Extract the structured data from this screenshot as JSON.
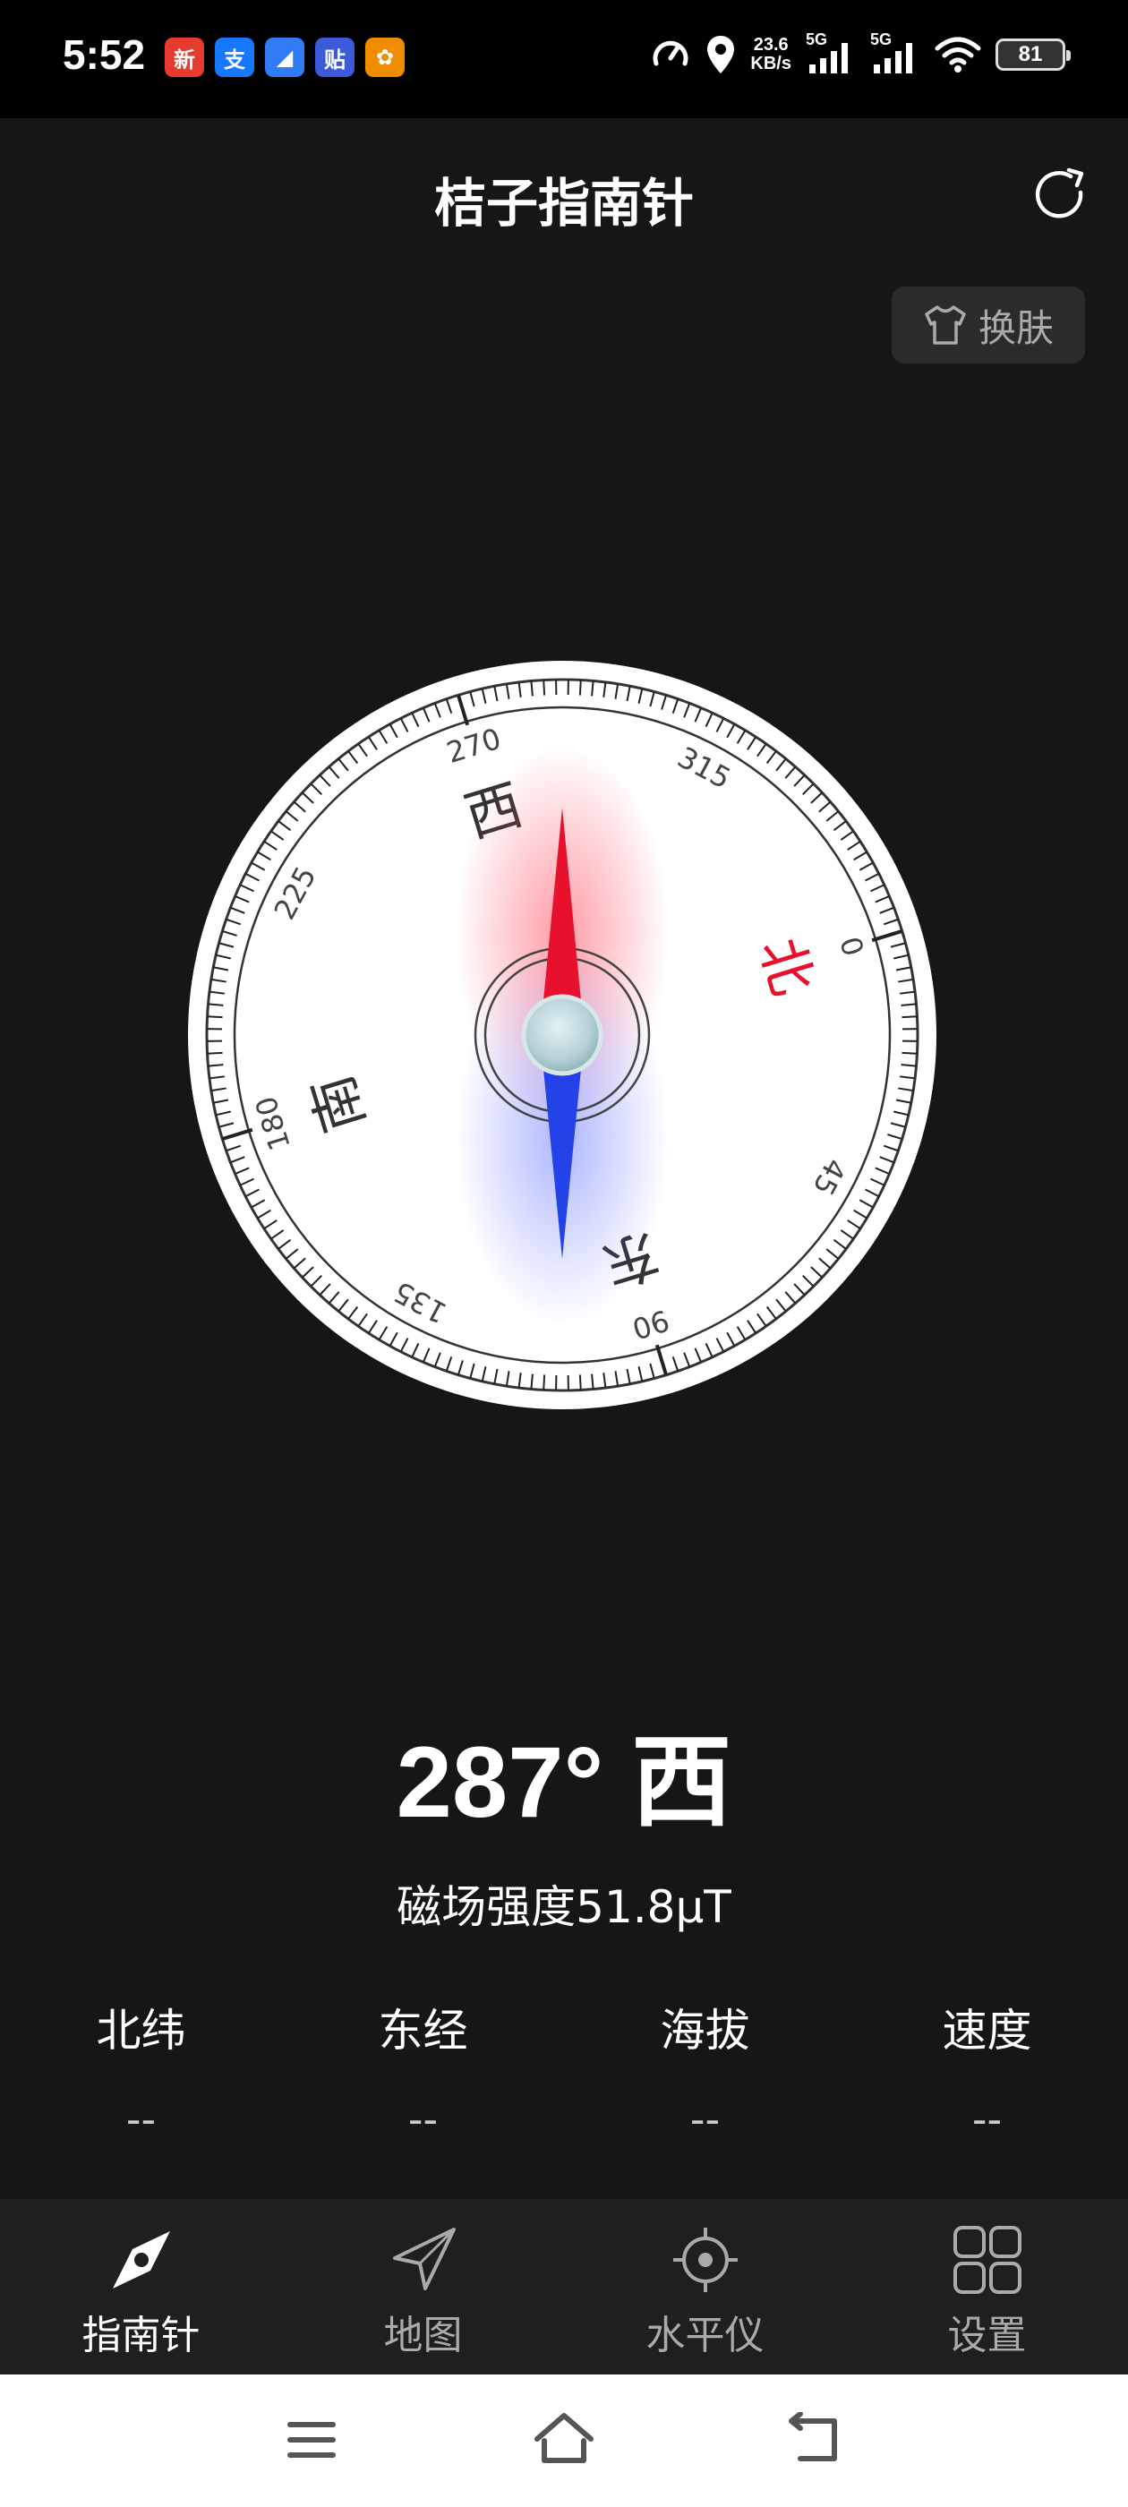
{
  "status_bar": {
    "time": "5:52",
    "notification_icons": [
      {
        "name": "news-app-icon",
        "glyph": "新",
        "color": "#e63b2e"
      },
      {
        "name": "alipay-icon",
        "glyph": "支",
        "color": "#1677ff"
      },
      {
        "name": "cloud-app-icon",
        "glyph": "◢",
        "color": "#2f7cf6"
      },
      {
        "name": "tieba-icon",
        "glyph": "贴",
        "color": "#3b5bdb"
      },
      {
        "name": "orange-app-icon",
        "glyph": "✿",
        "color": "#f08c00"
      }
    ],
    "net_speed_value": "23.6",
    "net_speed_unit": "KB/s",
    "signal_1_label": "5G",
    "signal_2_label": "5G",
    "battery": "81"
  },
  "header": {
    "title": "桔子指南针",
    "skin_label": "换肤"
  },
  "compass": {
    "heading_deg": 287,
    "north_color": "#e8112d",
    "south_color": "#2343e8",
    "cardinals": {
      "north": "北",
      "east": "东",
      "south": "南",
      "west": "西"
    },
    "degree_labels": [
      "0",
      "45",
      "90",
      "135",
      "180",
      "225",
      "270",
      "315"
    ]
  },
  "readout": {
    "heading_text": "287° 西",
    "field_strength": "磁场强度51.8μT"
  },
  "info": [
    {
      "label": "北纬",
      "value": "--"
    },
    {
      "label": "东经",
      "value": "--"
    },
    {
      "label": "海拔",
      "value": "--"
    },
    {
      "label": "速度",
      "value": "--"
    }
  ],
  "nav": [
    {
      "label": "指南针",
      "icon": "compass-icon",
      "active": true
    },
    {
      "label": "地图",
      "icon": "navigation-arrow-icon",
      "active": false
    },
    {
      "label": "水平仪",
      "icon": "crosshair-icon",
      "active": false
    },
    {
      "label": "设置",
      "icon": "grid-icon",
      "active": false
    }
  ]
}
